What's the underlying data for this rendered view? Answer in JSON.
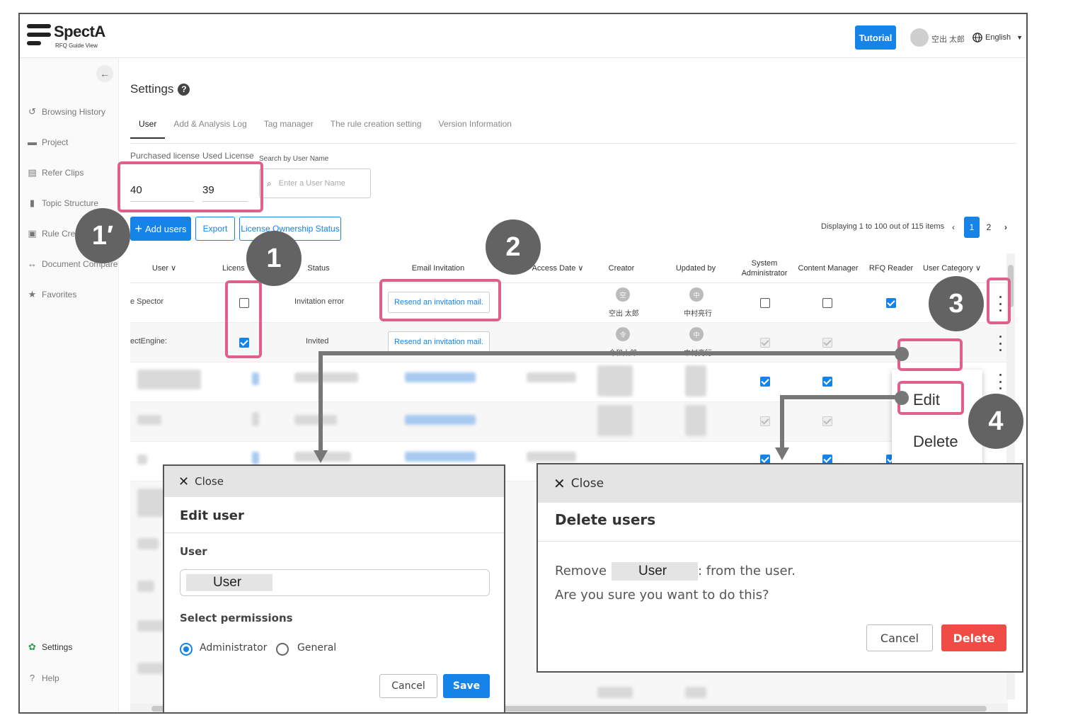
{
  "app": {
    "logo_text": "SpectA",
    "logo_sub": "RFQ Guide View",
    "tutorial_label": "Tutorial",
    "user_name": "空出 太郎",
    "language": "English"
  },
  "sidebar": {
    "items": [
      {
        "label": "Browsing History",
        "icon": "history-icon"
      },
      {
        "label": "Project",
        "icon": "briefcase-icon"
      },
      {
        "label": "Refer Clips",
        "icon": "clip-icon"
      },
      {
        "label": "Topic Structure",
        "icon": "clipboard-icon"
      },
      {
        "label": "Rule Crea",
        "icon": "rule-icon"
      },
      {
        "label": "Document Compare",
        "icon": "compare-icon"
      },
      {
        "label": "Favorites",
        "icon": "star-icon"
      }
    ],
    "settings_label": "Settings",
    "help_label": "Help"
  },
  "page": {
    "title": "Settings",
    "tabs": [
      "User",
      "Add & Analysis Log",
      "Tag manager",
      "The rule creation setting",
      "Version Information"
    ],
    "purchased_label": "Purchased license",
    "used_label": "Used License",
    "purchased_value": "40",
    "used_value": "39",
    "search_label": "Search by User Name",
    "search_placeholder": "Enter a User Name",
    "add_users": "Add users",
    "export": "Export",
    "ownership": "License Ownership Status",
    "paging_text": "Displaying 1 to 100 out of 115 items",
    "page_1": "1",
    "page_2": "2"
  },
  "table": {
    "headers": {
      "user": "User",
      "license": "Licens",
      "status": "Status",
      "email": "Email Invitation",
      "access": "Access Date",
      "creator": "Creator",
      "updated": "Updated by",
      "sysadmin_1": "System",
      "sysadmin_2": "Administrator",
      "content": "Content Manager",
      "rfq": "RFQ Reader",
      "category": "User Category"
    },
    "rows": [
      {
        "user": "e Spector",
        "status": "Invitation error",
        "email": "Resend an invitation mail.",
        "creator_initial": "空",
        "creator_name": "空出 太郎",
        "updated_initial": "中",
        "updated_name": "中村亮行"
      },
      {
        "user": "ectEngine:",
        "status": "Invited",
        "email": "Resend an invitation mail.",
        "creator_initial": "令",
        "creator_name": "令和太郎",
        "updated_initial": "中",
        "updated_name": "中村亮行"
      }
    ]
  },
  "context_menu": {
    "edit": "Edit",
    "delete": "Delete"
  },
  "badges": {
    "b1p": "1′",
    "b1": "1",
    "b2": "2",
    "b3": "3",
    "b4": "4"
  },
  "edit_modal": {
    "close": "Close",
    "title": "Edit user",
    "user_label": "User",
    "user_value": "User",
    "perm_label": "Select permissions",
    "admin": "Administrator",
    "general": "General",
    "cancel": "Cancel",
    "save": "Save"
  },
  "delete_modal": {
    "close": "Close",
    "title": "Delete users",
    "remove": "Remove",
    "user_value": "User",
    "from_user": ": from the user.",
    "confirm": "Are you sure you want to do this?",
    "cancel": "Cancel",
    "delete": "Delete"
  },
  "colors": {
    "accent": "#1683e8",
    "highlight": "#e0608a",
    "danger": "#f04b45",
    "badge": "#636363"
  }
}
